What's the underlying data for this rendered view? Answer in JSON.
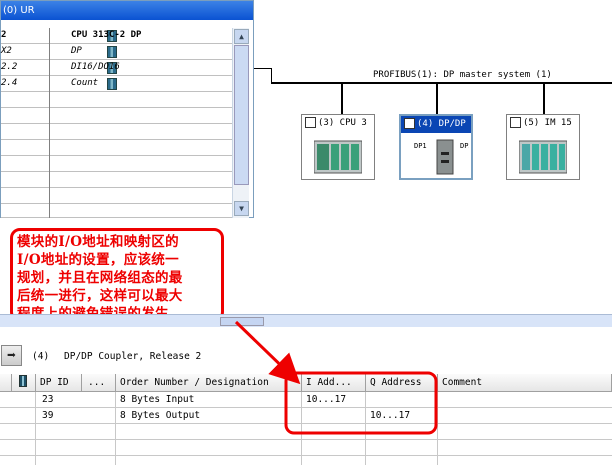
{
  "rack": {
    "title": "(0) UR",
    "rows": [
      {
        "slot": "2",
        "module": "CPU 313C-2 DP",
        "bold": true
      },
      {
        "slot": "X2",
        "module": "DP",
        "bold": false
      },
      {
        "slot": "2.2",
        "module": "DI16/DO16",
        "bold": false
      },
      {
        "slot": "2.4",
        "module": "Count",
        "bold": false
      }
    ]
  },
  "network": {
    "bus_label": "PROFIBUS(1): DP master system (1)",
    "stations": [
      {
        "label": "(3) CPU 3",
        "selected": false
      },
      {
        "label": "(4) DP/DP",
        "selected": true,
        "ports": [
          "DP1",
          "DP2"
        ]
      },
      {
        "label": "(5) IM 15",
        "selected": false
      }
    ]
  },
  "annotation": {
    "lines": [
      "模块的I/O地址和映射区的",
      "I/O地址的设置，应该统一",
      "规划，并且在网络组态的最",
      "后统一进行，这样可以最大",
      "程度上的避免错误的发生。"
    ],
    "color": "#e00000"
  },
  "detail": {
    "station_num": "(4)",
    "station_name": "DP/DP Coupler, Release 2",
    "headers": {
      "dpid": "DP ID",
      "more": "...",
      "order": "Order Number / Designation",
      "iaddr": "I Add...",
      "qaddr": "Q Address",
      "comment": "Comment"
    },
    "rows": [
      {
        "dpid": "23",
        "order": "8 Bytes Input",
        "iaddr": "10...17",
        "qaddr": ""
      },
      {
        "dpid": "39",
        "order": "8 Bytes Output",
        "iaddr": "",
        "qaddr": "10...17"
      }
    ]
  }
}
